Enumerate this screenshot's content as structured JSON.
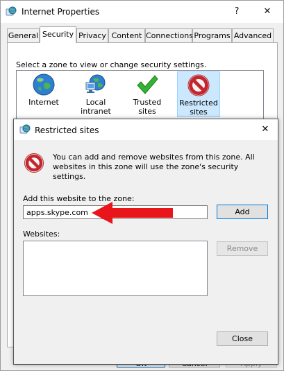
{
  "window": {
    "title": "Internet Properties",
    "help_glyph": "?",
    "close_glyph": "✕"
  },
  "tabs": [
    {
      "label": "General"
    },
    {
      "label": "Security",
      "active": true
    },
    {
      "label": "Privacy"
    },
    {
      "label": "Content"
    },
    {
      "label": "Connections"
    },
    {
      "label": "Programs"
    },
    {
      "label": "Advanced"
    }
  ],
  "security": {
    "zone_prompt": "Select a zone to view or change security settings.",
    "zones": [
      {
        "label": "Internet",
        "icon": "globe-icon"
      },
      {
        "label": "Local intranet",
        "icon": "network-icon"
      },
      {
        "label": "Trusted sites",
        "icon": "checkmark-icon"
      },
      {
        "label": "Restricted sites",
        "line1": "Restricted",
        "line2": "sites",
        "icon": "prohibited-icon",
        "selected": true
      }
    ]
  },
  "footer": {
    "ok": "OK",
    "cancel": "Cancel",
    "apply": "Apply"
  },
  "dialog": {
    "title": "Restricted sites",
    "close_glyph": "✕",
    "info": "You can add and remove websites from this zone. All websites in this zone will use the zone's security settings.",
    "add_label": "Add this website to the zone:",
    "url_value": "apps.skype.com",
    "add_button": "Add",
    "websites_label": "Websites:",
    "remove_button": "Remove",
    "close_button": "Close"
  },
  "colors": {
    "accent": "#0078d7",
    "arrow": "#e8161b",
    "prohibited": "#c4262e"
  }
}
